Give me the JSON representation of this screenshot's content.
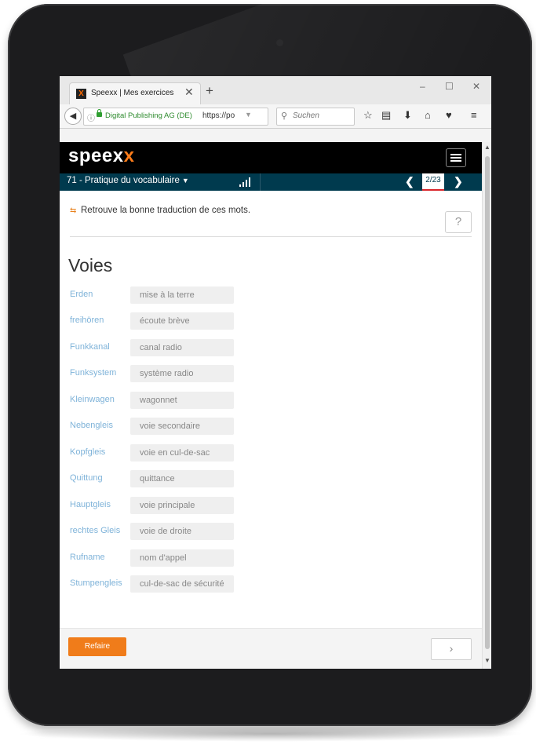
{
  "browser": {
    "tab_title": "Speexx | Mes exercices",
    "tab_favicon": "X",
    "tab_close": "✕",
    "new_tab": "+",
    "window_controls": [
      "–",
      "☐",
      "✕"
    ],
    "site_identity": "Digital Publishing AG (DE)",
    "url": "https://po",
    "search_placeholder": "Suchen",
    "toolbar_icons": [
      "star-icon",
      "reader-icon",
      "download-icon",
      "home-icon",
      "pocket-icon",
      "menu-icon"
    ]
  },
  "app": {
    "logo_main": "speex",
    "logo_accent": "x",
    "brand_accent_color": "#ff7d1a",
    "lesson_title": "71 - Pratique du vocabulaire",
    "page_indicator": "2/23"
  },
  "exercise": {
    "instruction": "Retrouve la bonne traduction de ces mots.",
    "help_label": "?",
    "title": "Voies",
    "items": [
      {
        "term": "Erden",
        "answer": "mise à la terre"
      },
      {
        "term": "freihören",
        "answer": "écoute brève"
      },
      {
        "term": "Funkkanal",
        "answer": "canal radio"
      },
      {
        "term": "Funksystem",
        "answer": "système radio"
      },
      {
        "term": "Kleinwagen",
        "answer": "wagonnet"
      },
      {
        "term": "Nebengleis",
        "answer": "voie secondaire"
      },
      {
        "term": "Kopfgleis",
        "answer": "voie en cul-de-sac"
      },
      {
        "term": "Quittung",
        "answer": "quittance"
      },
      {
        "term": "Hauptgleis",
        "answer": "voie principale"
      },
      {
        "term": "rechtes Gleis",
        "answer": "voie de droite"
      },
      {
        "term": "Rufname",
        "answer": "nom d'appel"
      },
      {
        "term": "Stumpengleis",
        "answer": "cul-de-sac de sécurité"
      }
    ]
  },
  "footer": {
    "redo_label": "Refaire",
    "next_label": "›"
  }
}
